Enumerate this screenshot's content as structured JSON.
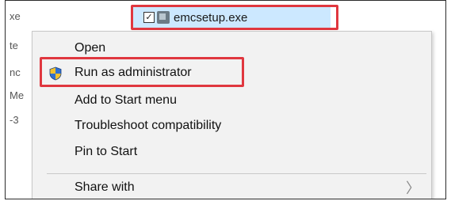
{
  "background_list": {
    "items": [
      "xe",
      "te",
      "nc",
      "Me",
      "-3"
    ]
  },
  "selected_file": {
    "name": "emcsetup.exe",
    "checked": true,
    "checkbox_glyph": "✓",
    "icon": "application-icon"
  },
  "context_menu": {
    "items": [
      {
        "label": "Open"
      },
      {
        "label": "Run as administrator",
        "icon": "uac-shield-icon"
      },
      {
        "label": "Add to Start menu"
      },
      {
        "label": "Troubleshoot compatibility"
      },
      {
        "label": "Pin to Start"
      },
      {
        "label": "Share with",
        "submenu": true,
        "submenu_glyph": "〉"
      }
    ]
  },
  "annotations": {
    "highlight_color": "#e0373f",
    "highlighted": [
      "selected_file",
      "Run as administrator"
    ]
  },
  "colors": {
    "selection": "#cce8ff",
    "menu_background": "#f2f2f2"
  }
}
